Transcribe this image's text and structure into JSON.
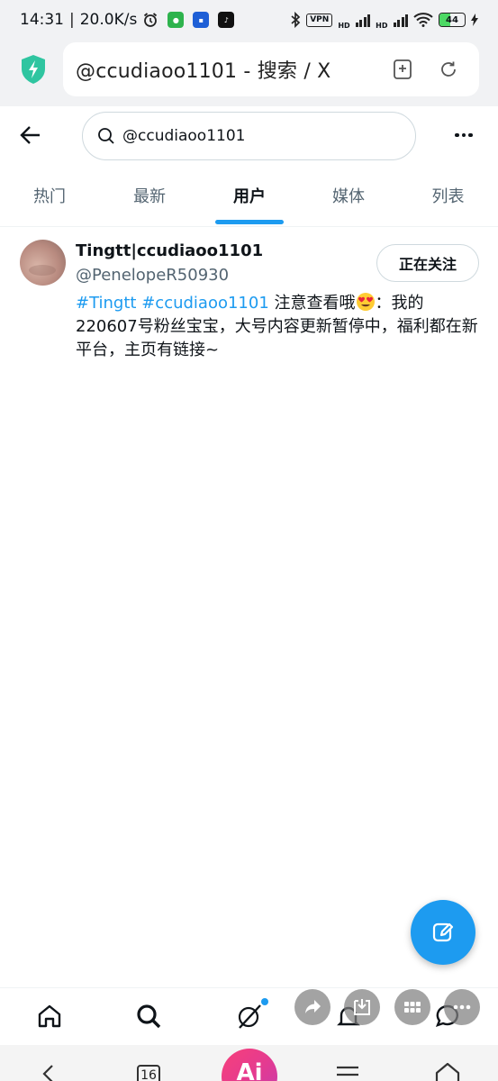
{
  "status_bar": {
    "time": "14:31",
    "separator": "|",
    "network_speed": "20.0K/s",
    "vpn_label": "VPN",
    "signal_label_1": "HD",
    "signal_label_2": "HD",
    "battery_level": "44",
    "battery_fraction": 0.44
  },
  "browser": {
    "url_title": "@ccudiaoo1101 - 搜索 / X"
  },
  "header": {
    "search_value": "@ccudiaoo1101"
  },
  "tabs": [
    {
      "label": "热门",
      "active": false
    },
    {
      "label": "最新",
      "active": false
    },
    {
      "label": "用户",
      "active": true
    },
    {
      "label": "媒体",
      "active": false
    },
    {
      "label": "列表",
      "active": false
    }
  ],
  "user_result": {
    "display_name": "Tingtt|ccudiaoo1101",
    "handle": "@PenelopeR50930",
    "follow_label": "正在关注",
    "bio_tag1": "#Tingtt",
    "bio_tag2": "#ccudiaoo1101",
    "bio_text1": "注意查看哦",
    "bio_text2": "：我的220607号粉丝宝宝，大号内容更新暂停中，福利都在新平台，主页有链接~"
  },
  "system_nav": {
    "tab_count": "16",
    "ai_label": "Ai"
  },
  "colors": {
    "accent": "#1d9bf0",
    "primary_text": "#0f1419",
    "secondary_text": "#536471",
    "ai_gradient_start": "#f7407a"
  },
  "icons": {
    "browser_shield": "shield-lightning-icon",
    "bookmark": "bookmark-add-icon",
    "reload": "reload-icon",
    "back": "arrow-left-icon",
    "search": "search-icon",
    "more": "more-horizontal-icon",
    "compose": "compose-icon",
    "home": "home-icon",
    "explore": "search-icon",
    "grok": "grok-icon",
    "notifications": "bell-icon",
    "messages": "message-icon",
    "share": "share-icon",
    "download": "download-icon",
    "apps": "apps-grid-icon",
    "menu": "more-horizontal-icon"
  }
}
